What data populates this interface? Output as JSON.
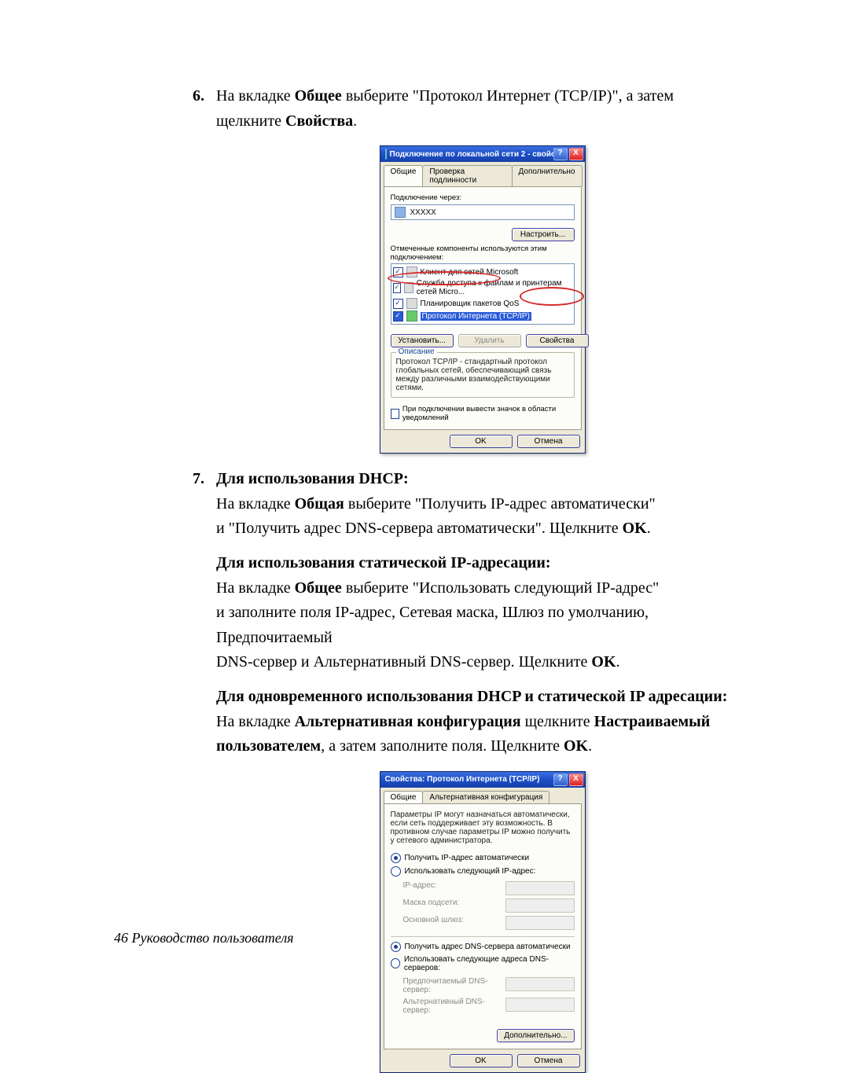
{
  "step6": {
    "num": "6.",
    "t1a": "На вкладке ",
    "t1b": "Общее",
    "t1c": " выберите \"Протокол Интернет (TCP/IP)\", а затем",
    "t2a": "щелкните ",
    "t2b": "Свойства",
    "t2c": "."
  },
  "dlg1": {
    "title": "Подключение по локальной сети 2 - свойс…",
    "help": "?",
    "close": "X",
    "tabs": {
      "general": "Общие",
      "auth": "Проверка подлинности",
      "adv": "Дополнительно"
    },
    "connect_label": "Подключение через:",
    "adapter": "XXXXX",
    "configure": "Настроить...",
    "components_label": "Отмеченные компоненты используются этим подключением:",
    "items": {
      "client": "Клиент для сетей Microsoft",
      "share": "Служба доступа к файлам и принтерам сетей Micro...",
      "qos": "Планировщик пакетов QoS",
      "tcpip": "Протокол Интернета (TCP/IP)"
    },
    "install": "Установить...",
    "remove": "Удалить",
    "props": "Свойства",
    "desc_title": "Описание",
    "desc": "Протокол TCP/IP - стандартный протокол глобальных сетей, обеспечивающий связь между различными взаимодействующими сетями.",
    "tray": "При подключении вывести значок в области уведомлений",
    "ok": "OK",
    "cancel": "Отмена"
  },
  "step7": {
    "num": "7.",
    "h1": "Для использования DHCP:",
    "p1a": "На вкладке ",
    "p1b": "Общая",
    "p1c": " выберите \"Получить IP-адрес автоматически\"",
    "p2a": "и \"Получить адрес DNS-сервера автоматически\". Щелкните ",
    "p2b": "OK",
    "p2c": ".",
    "h2": "Для использования статической IP-адресации:",
    "s1a": "На вкладке ",
    "s1b": "Общее",
    "s1c": " выберите \"Использовать следующий IP-адрес\"",
    "s2": "и заполните поля IP-адрес, Сетевая маска, Шлюз по умолчанию,",
    "s3": "Предпочитаемый",
    "s4a": "DNS-сервер и Альтернативный DNS-сервер. Щелкните ",
    "s4b": "OK",
    "s4c": ".",
    "h3": "Для одновременного использования DHCP и статической IP адресации:",
    "a1a": "На вкладке ",
    "a1b": "Альтернативная конфигурация",
    "a1c": " щелкните ",
    "a1d": "Настраиваемый",
    "a2a": "пользователем",
    "a2b": ", а затем заполните поля. Щелкните ",
    "a2c": "OK",
    "a2d": "."
  },
  "dlg2": {
    "title": "Свойства: Протокол Интернета (TCP/IP)",
    "help": "?",
    "close": "X",
    "tabs": {
      "general": "Общие",
      "alt": "Альтернативная конфигурация"
    },
    "intro": "Параметры IP могут назначаться автоматически, если сеть поддерживает эту возможность. В противном случае параметры IP можно получить у сетевого администратора.",
    "r_auto_ip": "Получить IP-адрес автоматически",
    "r_use_ip": "Использовать следующий IP-адрес:",
    "ip_label": "IP-адрес:",
    "mask_label": "Маска подсети:",
    "gw_label": "Основной шлюз:",
    "r_auto_dns": "Получить адрес DNS-сервера автоматически",
    "r_use_dns": "Использовать следующие адреса DNS-серверов:",
    "dns1_label": "Предпочитаемый DNS-сервер:",
    "dns2_label": "Альтернативный DNS-сервер:",
    "advanced": "Дополнительно...",
    "ok": "OK",
    "cancel": "Отмена"
  },
  "footer": "46  Руководство пользователя"
}
